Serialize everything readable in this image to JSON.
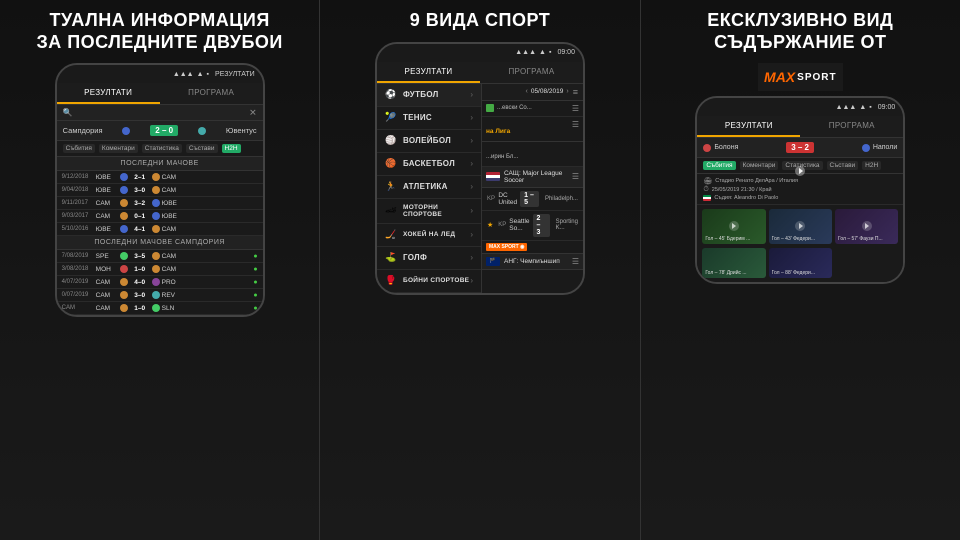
{
  "panels": [
    {
      "title": "ТУАЛНА ИНФОРМАЦИЯ\nЗА ПОСЛЕДНИТЕ ДВУБОИ",
      "tabs": [
        "РЕЗУЛТАТИ",
        "ПРОГРАМА"
      ],
      "active_tab": "РЕЗУЛТАТИ",
      "match": {
        "home": "Сампдория",
        "away": "Ювентус",
        "score": "2–0"
      },
      "match_tabs": [
        "Събития",
        "Коментари",
        "Статистика",
        "Състави",
        "H2H"
      ],
      "active_match_tab": "H2H",
      "sections": [
        {
          "header": "ПОСЛЕДНИ МАЧОВЕ",
          "rows": [
            {
              "date": "9/12/2018",
              "home": "ЮВЕ",
              "score": "2–1",
              "away": "CAM"
            },
            {
              "date": "9/04/2018",
              "home": "ЮВЕ",
              "score": "3–0",
              "away": "CAM"
            },
            {
              "date": "9/11/2017",
              "home": "CAM",
              "score": "3–2",
              "away": "ЮВЕ"
            },
            {
              "date": "9/03/2017",
              "home": "CAM",
              "score": "0–1",
              "away": "ЮВЕ"
            },
            {
              "date": "5/10/2016",
              "home": "ЮВЕ",
              "score": "4–1",
              "away": "CAM"
            }
          ]
        },
        {
          "header": "ПОСЛЕДНИ МАЧОВЕ САМПДОРИЯ",
          "rows": [
            {
              "date": "7/08/2019",
              "home": "SPE",
              "score": "3–5",
              "away": "CAM"
            },
            {
              "date": "3/08/2018",
              "home": "МОН",
              "score": "1–0",
              "away": "CAM"
            },
            {
              "date": "4/07/2019",
              "home": "CAM",
              "score": "4–0",
              "away": "PRO"
            },
            {
              "date": "0/07/2019",
              "home": "CAM",
              "score": "3–0",
              "away": "REV"
            },
            {
              "date": "CAM",
              "home": "CAM",
              "score": "1–0",
              "away": "SLN"
            }
          ]
        }
      ]
    },
    {
      "title": "9 ВИДА СПОРТ",
      "tabs": [
        "РЕЗУЛТАТИ",
        "ПРОГРАМА"
      ],
      "active_tab": "РЕЗУЛТАТИ",
      "sports": [
        {
          "label": "ФУТБОЛ",
          "icon": "⚽",
          "active": true
        },
        {
          "label": "ТЕНИС",
          "icon": "🎾"
        },
        {
          "label": "ВОЛЕЙБОЛ",
          "icon": "🏐"
        },
        {
          "label": "БАСКЕТБОЛ",
          "icon": "🏀"
        },
        {
          "label": "АТЛЕТИКА",
          "icon": "🏃"
        },
        {
          "label": "МОТОРНИ СПОРТОВЕ",
          "icon": "🏎"
        },
        {
          "label": "ХОКЕЙ НА ЛЕД",
          "icon": "🏒"
        },
        {
          "label": "ГОЛФ",
          "icon": "⛳"
        },
        {
          "label": "БОЙНИ СПОРТОВЕ",
          "icon": "🥊"
        }
      ],
      "leagues": [
        {
          "flag": "🇺🇸",
          "name": "САЩ: Major League Soccer",
          "matches": [
            {
              "type": "KP",
              "home": "DC United",
              "score": "1–5",
              "away": "Philadelph..."
            },
            {
              "type": "KP",
              "home": "Seattle So...",
              "score": "2–3",
              "away": "Sporting K..."
            }
          ]
        },
        {
          "flag": "🏴",
          "name": "АНГ: Чемпиъншип",
          "matches": []
        }
      ]
    },
    {
      "title": "ЕКСКЛУЗИВНО ВИД\nСЪДЪРЖАНИЕ ОТ",
      "brand": {
        "max": "MAX",
        "sport": "SPORT"
      },
      "tabs": [
        "РЕЗУЛТАТИ",
        "ПРОГРАМА"
      ],
      "active_tab": "РЕЗУЛТАТИ",
      "match": {
        "home": "Болоня",
        "away": "Наполи",
        "score": "3–2"
      },
      "match_tabs": [
        "Събития",
        "Коментари",
        "Статистика",
        "Състави",
        "H2H"
      ],
      "venue": "Стадио Ренато ДелАра / Италия",
      "datetime": "25/05/2019 21:30 / Край",
      "referee": "Съдия: Aleandro Di Paolo",
      "video_labels": [
        "Гол – 45' Бдерим ...",
        "Гол – 43' Федери...",
        "Гол – 57' Фаузи П..."
      ],
      "video_labels2": [
        "Гол – 78' Дрийс ...",
        "Гол – 88' Федери..."
      ]
    }
  ]
}
